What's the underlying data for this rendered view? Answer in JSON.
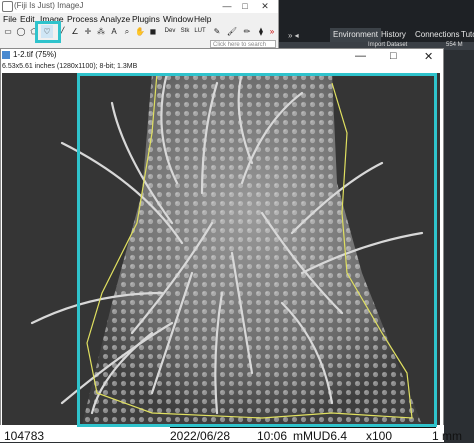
{
  "fiji": {
    "title": "(Fiji Is Just) ImageJ",
    "menus": [
      "File",
      "Edit",
      "Image",
      "Process",
      "Analyze",
      "Plugins",
      "Window",
      "Help"
    ],
    "tools": [
      "rectangle-tool",
      "oval-tool",
      "polygon-tool",
      "freehand-tool",
      "line-tool",
      "angle-tool",
      "point-tool",
      "wand-tool",
      "text-tool",
      "magnifier-tool",
      "hand-tool",
      "color-picker-tool",
      "dev-tool",
      "stk-tool",
      "lut-tool",
      "pen-tool",
      "brush-tool",
      "pencil-tool",
      "flood-tool",
      "more-tool"
    ],
    "tool_labels": {
      "dev": "Dev",
      "stk": "Stk",
      "lut": "LUT"
    },
    "search_placeholder": "Click here to search",
    "window_buttons": [
      "—",
      "□",
      "✕"
    ]
  },
  "background_app": {
    "tabs": [
      "Environment",
      "History",
      "Connections",
      "Tuto"
    ],
    "toolbar_item": "Import Dataset",
    "memory": "554 M"
  },
  "image_window": {
    "title": "1-2.tif (75%)",
    "info": "6.53x5.61 inches (1280x1100); 8-bit; 1.3MB",
    "window_buttons": [
      "—",
      "□",
      "✕"
    ]
  },
  "sem_overlay": {
    "id": "104783",
    "date": "2022/06/28",
    "time": "10:06",
    "mode": "mMUD6.4",
    "magnification": "x100",
    "scale": "1 mm"
  },
  "colors": {
    "highlight": "#2fc3cc",
    "selection": "#e0e060"
  }
}
